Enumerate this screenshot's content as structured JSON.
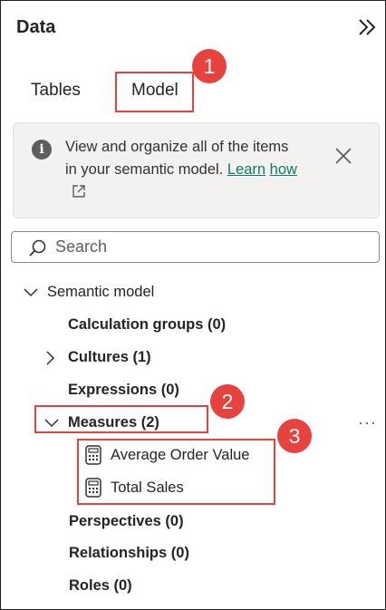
{
  "panel": {
    "title": "Data"
  },
  "tabs": [
    {
      "label": "Tables"
    },
    {
      "label": "Model"
    }
  ],
  "info": {
    "text": "View and organize all of the items in your semantic model.",
    "link_part1": "Learn",
    "link_part2": "how"
  },
  "search": {
    "placeholder": "Search"
  },
  "tree": {
    "root": {
      "label": "Semantic model"
    },
    "items": [
      {
        "label": "Calculation groups (0)"
      },
      {
        "label": "Cultures (1)"
      },
      {
        "label": "Expressions (0)"
      },
      {
        "label": "Measures (2)"
      },
      {
        "label": "Perspectives (0)"
      },
      {
        "label": "Relationships (0)"
      },
      {
        "label": "Roles (0)"
      }
    ],
    "measures": [
      {
        "label": "Average Order Value"
      },
      {
        "label": "Total Sales"
      }
    ],
    "more_label": "···"
  },
  "callouts": [
    {
      "number": "1"
    },
    {
      "number": "2"
    },
    {
      "number": "3"
    }
  ],
  "colors": {
    "callout": "#e8423f",
    "link": "#117865",
    "info_bg": "#f3f2f1"
  }
}
